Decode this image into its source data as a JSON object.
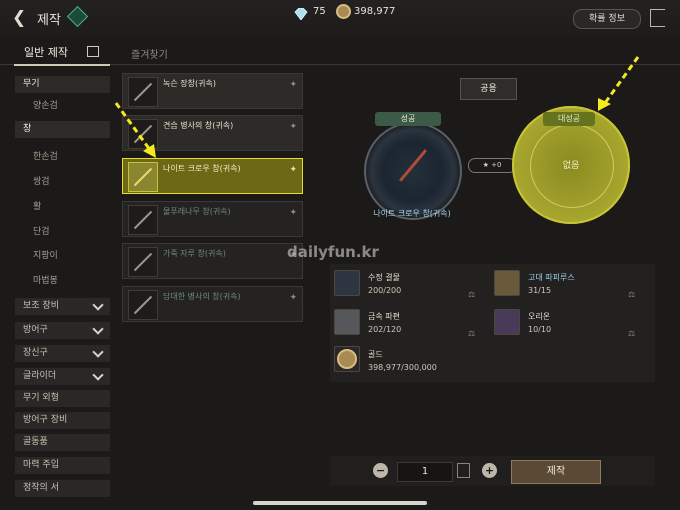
{
  "header": {
    "title": "제작",
    "crystal": "75",
    "gold": "398,977",
    "prob_button": "확률 정보"
  },
  "tabs": [
    {
      "label": "일반 제작"
    },
    {
      "label": "즐겨찾기"
    }
  ],
  "menu": [
    {
      "label": "무기"
    },
    {
      "label": "양손검"
    },
    {
      "label": "창"
    },
    {
      "label": "한손검"
    },
    {
      "label": "쌍검"
    },
    {
      "label": "활"
    },
    {
      "label": "단검"
    },
    {
      "label": "지팡이"
    },
    {
      "label": "마법봉"
    },
    {
      "label": "보조 장비"
    },
    {
      "label": "방어구"
    },
    {
      "label": "장신구"
    },
    {
      "label": "글라이더"
    },
    {
      "label": "무기 외형"
    },
    {
      "label": "방어구 장비"
    },
    {
      "label": "골동품"
    },
    {
      "label": "마력 주입"
    },
    {
      "label": "정작의 서"
    }
  ],
  "items": [
    {
      "name": "녹슨 장창(귀속)"
    },
    {
      "name": "견습 병사의 창(귀속)"
    },
    {
      "name": "나이트 크로우 창(귀속)"
    },
    {
      "name": "물푸레나무 창(귀속)"
    },
    {
      "name": "가죽 자루 창(귀속)"
    },
    {
      "name": "담대한 병사의 창(귀속)"
    }
  ],
  "craft_preview": {
    "common_label": "공용",
    "success_label": "성공",
    "success_item": "나이트 크로우 창(귀속)",
    "bonus": "+0",
    "great_success_label": "대성공",
    "great_success_value": "없음"
  },
  "materials": [
    {
      "name": "수정 결물",
      "count": "200/200"
    },
    {
      "name": "고대 파피루스",
      "count": "31/15"
    },
    {
      "name": "금속 파편",
      "count": "202/120"
    },
    {
      "name": "오리온",
      "count": "10/10"
    },
    {
      "name": "골드",
      "count": "398,977/300,000"
    }
  ],
  "footer": {
    "quantity": "1",
    "craft_button": "제작"
  },
  "watermark": "dailyfun.kr",
  "colors": {
    "highlight": "#e5dd2a",
    "great_success": "#a4a32d",
    "accent_blue": "#a7d6ef"
  },
  "icons": [
    "back-icon",
    "crystal-icon",
    "gold-coin-icon",
    "exit-icon",
    "favorite-star-icon",
    "minus-icon",
    "plus-icon",
    "calculator-icon",
    "scale-icon"
  ]
}
